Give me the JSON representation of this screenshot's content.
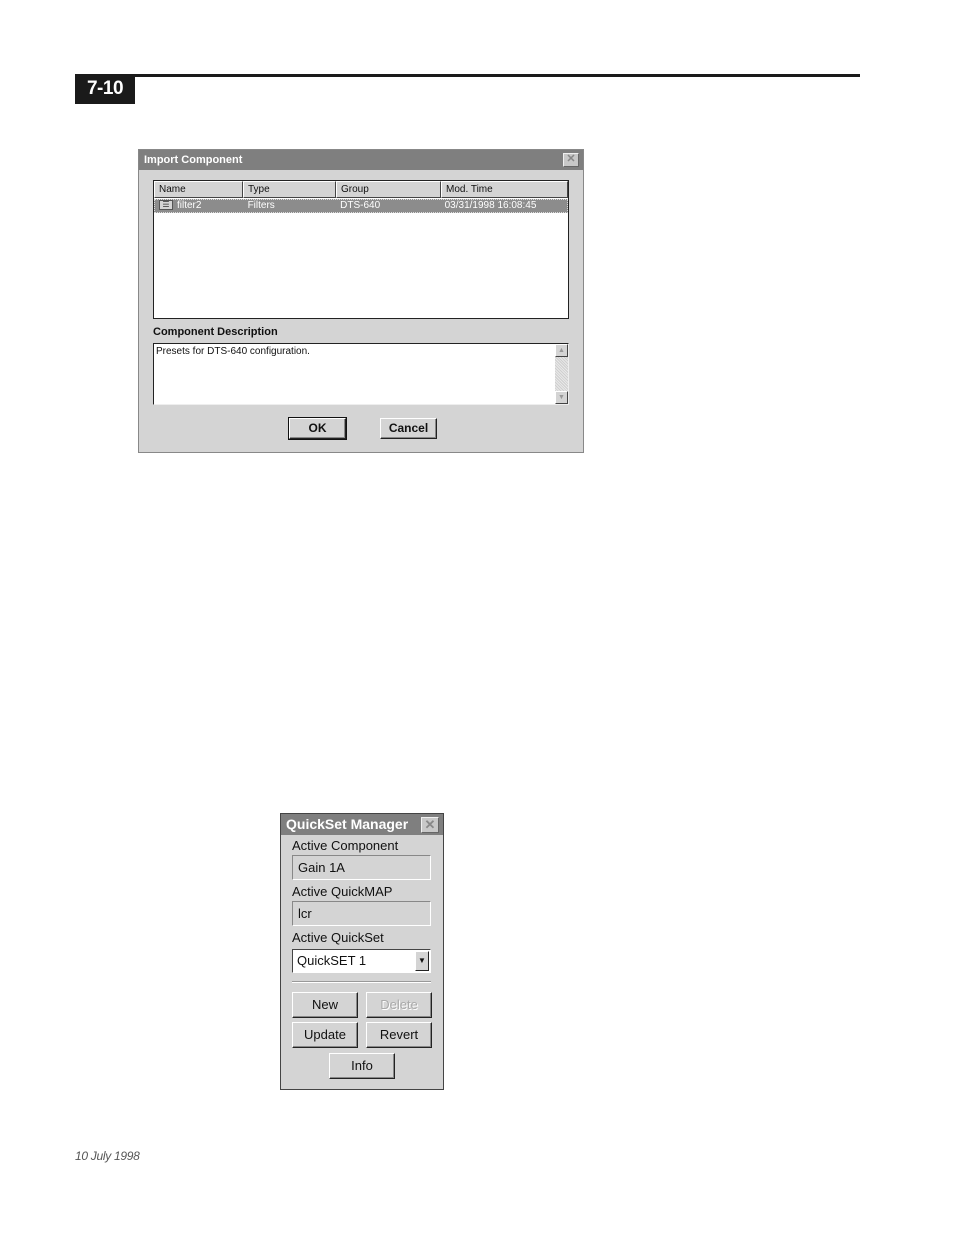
{
  "page": {
    "number": "7-10",
    "footer_date": "10 July 1998"
  },
  "import_dialog": {
    "title": "Import Component",
    "close_glyph": "✕",
    "columns": [
      "Name",
      "Type",
      "Group",
      "Mod. Time"
    ],
    "rows": [
      {
        "icon": "component-icon",
        "name": "filter2",
        "type": "Filters",
        "group": "DTS-640",
        "mod_time": "03/31/1998 16:08:45",
        "selected": true
      }
    ],
    "description_label": "Component Description",
    "description_text": "Presets for DTS-640 configuration.",
    "ok_label": "OK",
    "cancel_label": "Cancel"
  },
  "quickset_manager": {
    "title": "QuickSet Manager",
    "close_glyph": "✕",
    "active_component_label": "Active Component",
    "active_component_value": "Gain 1A",
    "active_quickmap_label": "Active QuickMAP",
    "active_quickmap_value": "lcr",
    "active_quickset_label": "Active QuickSet",
    "active_quickset_value": "QuickSET 1",
    "buttons": {
      "new": "New",
      "delete": "Delete",
      "update": "Update",
      "revert": "Revert",
      "info": "Info"
    }
  }
}
